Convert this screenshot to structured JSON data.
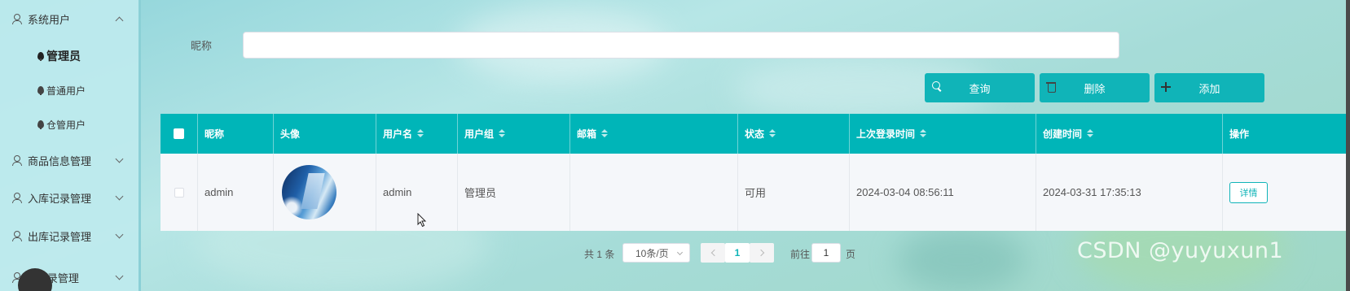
{
  "sidebar": {
    "groups": [
      {
        "label": "系统用户",
        "icon": "user-icon",
        "expanded": true
      },
      {
        "label": "商品信息管理",
        "icon": "user-icon",
        "expanded": false
      },
      {
        "label": "入库记录管理",
        "icon": "user-icon",
        "expanded": false
      },
      {
        "label": "出库记录管理",
        "icon": "user-icon",
        "expanded": false
      },
      {
        "label": "...记录管理",
        "icon": "user-icon",
        "expanded": false
      }
    ],
    "sub_items": [
      {
        "label": "管理员",
        "active": true
      },
      {
        "label": "普通用户",
        "active": false
      },
      {
        "label": "仓管用户",
        "active": false
      }
    ]
  },
  "search": {
    "label": "昵称",
    "value": "",
    "placeholder": ""
  },
  "toolbar": {
    "query_label": "查询",
    "delete_label": "删除",
    "add_label": "添加"
  },
  "table": {
    "headers": [
      "昵称",
      "头像",
      "用户名",
      "用户组",
      "邮箱",
      "状态",
      "上次登录时间",
      "创建时间",
      "操作"
    ],
    "rows": [
      {
        "nickname": "admin",
        "username": "admin",
        "group": "管理员",
        "email": "",
        "status": "可用",
        "last_login": "2024-03-04 08:56:11",
        "created": "2024-03-31 17:35:13",
        "action": "详情"
      }
    ]
  },
  "pagination": {
    "total": "共 1 条",
    "page_size": "10条/页",
    "current_page": "1",
    "goto_label": "前往",
    "goto_value": "1",
    "page_suffix": "页"
  },
  "watermark": "CSDN @yuyuxun1",
  "colors": {
    "accent": "#00b5b8",
    "sidebar_bg": "#bee9ee"
  }
}
